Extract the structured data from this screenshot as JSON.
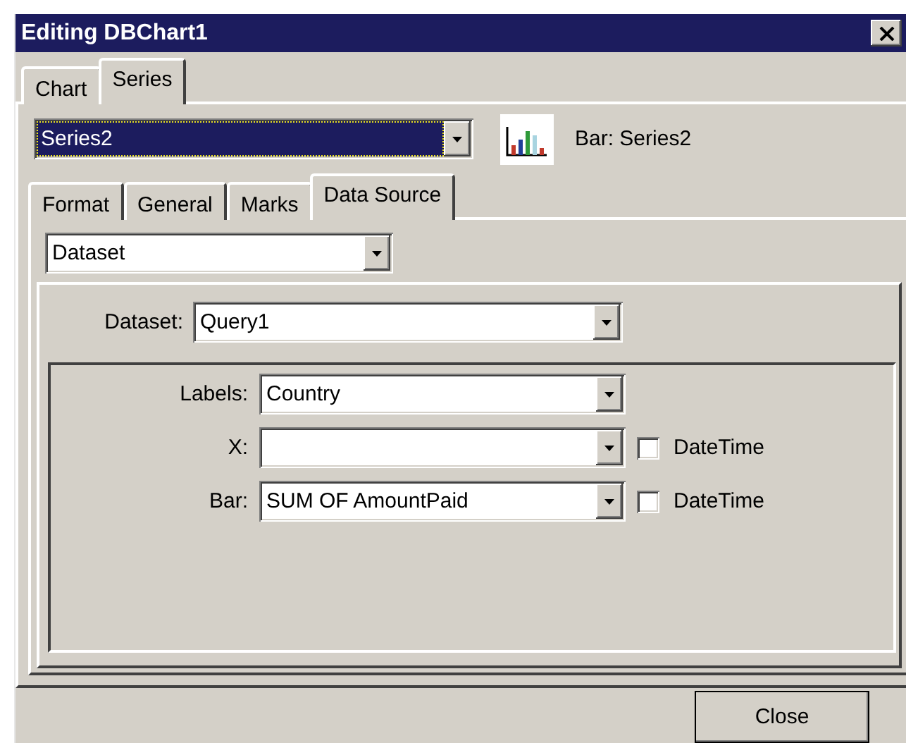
{
  "window": {
    "title": "Editing DBChart1"
  },
  "tabs": [
    {
      "label": "Chart",
      "selected": false
    },
    {
      "label": "Series",
      "selected": true
    }
  ],
  "series_select": {
    "value": "Series2",
    "focused": true
  },
  "series_label": "Bar: Series2",
  "series_tabs": [
    {
      "label": "Format",
      "selected": false
    },
    {
      "label": "General",
      "selected": false
    },
    {
      "label": "Marks",
      "selected": false
    },
    {
      "label": "Data Source",
      "selected": true
    }
  ],
  "source_select": {
    "value": "Dataset"
  },
  "dataset": {
    "label": "Dataset:",
    "value": "Query1"
  },
  "fields": [
    {
      "label": "Labels:",
      "value": "Country"
    },
    {
      "label": "X:",
      "datetime": {
        "label": "DateTime",
        "checked": false
      }
    },
    {
      "label": "Bar:",
      "value": "SUM OF AmountPaid",
      "datetime": {
        "label": "DateTime",
        "checked": false
      }
    }
  ],
  "buttons": [
    {
      "label": "Close"
    }
  ]
}
